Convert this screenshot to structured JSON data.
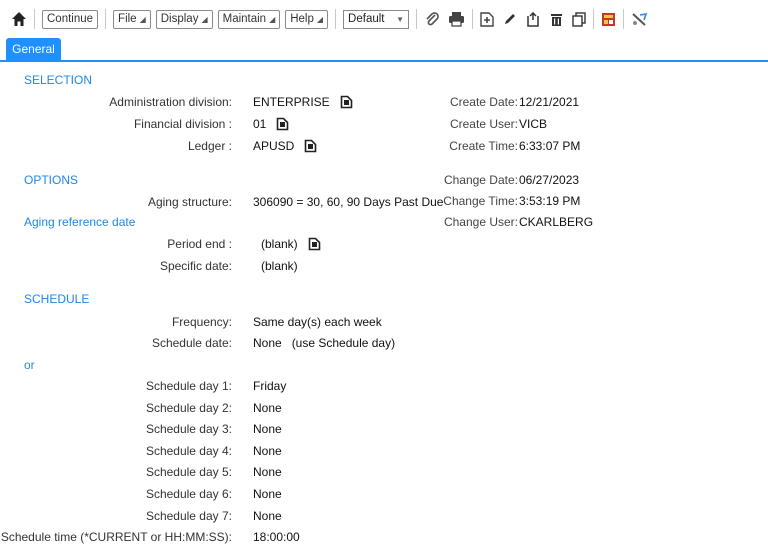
{
  "toolbar": {
    "continue": "Continue",
    "file": "File",
    "display": "Display",
    "maintain": "Maintain",
    "help": "Help",
    "view_select": "Default"
  },
  "tabs": {
    "general": "General"
  },
  "selection": {
    "heading": "SELECTION",
    "admin_division_label": "Administration division:",
    "admin_division_value": "ENTERPRISE",
    "financial_division_label": "Financial division :",
    "financial_division_value": "01",
    "ledger_label": "Ledger :",
    "ledger_value": "APUSD"
  },
  "audit": {
    "create_date_label": "Create Date:",
    "create_date_value": "12/21/2021",
    "create_user_label": "Create User:",
    "create_user_value": "VICB",
    "create_time_label": "Create Time:",
    "create_time_value": "6:33:07 PM",
    "change_date_label": "Change Date:",
    "change_date_value": "06/27/2023",
    "change_time_label": "Change Time:",
    "change_time_value": "3:53:19 PM",
    "change_user_label": "Change User:",
    "change_user_value": "CKARLBERG"
  },
  "options": {
    "heading": "OPTIONS",
    "aging_structure_label": "Aging structure:",
    "aging_structure_value": "306090 = 30, 60, 90 Days Past Due",
    "aging_reference_heading": "Aging reference date",
    "period_end_label": "Period end :",
    "period_end_value": "(blank)",
    "specific_date_label": "Specific date:",
    "specific_date_value": "(blank)"
  },
  "schedule": {
    "heading": "SCHEDULE",
    "frequency_label": "Frequency:",
    "frequency_value": "Same day(s) each week",
    "schedule_date_label": "Schedule date:",
    "schedule_date_value": "None   (use Schedule day)",
    "or_label": "or",
    "days": [
      {
        "label": "Schedule day 1:",
        "value": "Friday"
      },
      {
        "label": "Schedule day 2:",
        "value": "None"
      },
      {
        "label": "Schedule day 3:",
        "value": "None"
      },
      {
        "label": "Schedule day 4:",
        "value": "None"
      },
      {
        "label": "Schedule day 5:",
        "value": "None"
      },
      {
        "label": "Schedule day 6:",
        "value": "None"
      },
      {
        "label": "Schedule day 7:",
        "value": "None"
      }
    ],
    "time_label": "Schedule time (*CURRENT or HH:MM:SS):",
    "time_value": "18:00:00"
  },
  "colors": {
    "accent": "#1e90ff",
    "section": "#1e88e5"
  },
  "icons": [
    "home-icon",
    "paperclip-icon",
    "print-icon",
    "add-icon",
    "edit-icon",
    "copy-record-icon",
    "delete-icon",
    "duplicate-icon",
    "report-icon",
    "tools-icon",
    "lookup-icon"
  ]
}
